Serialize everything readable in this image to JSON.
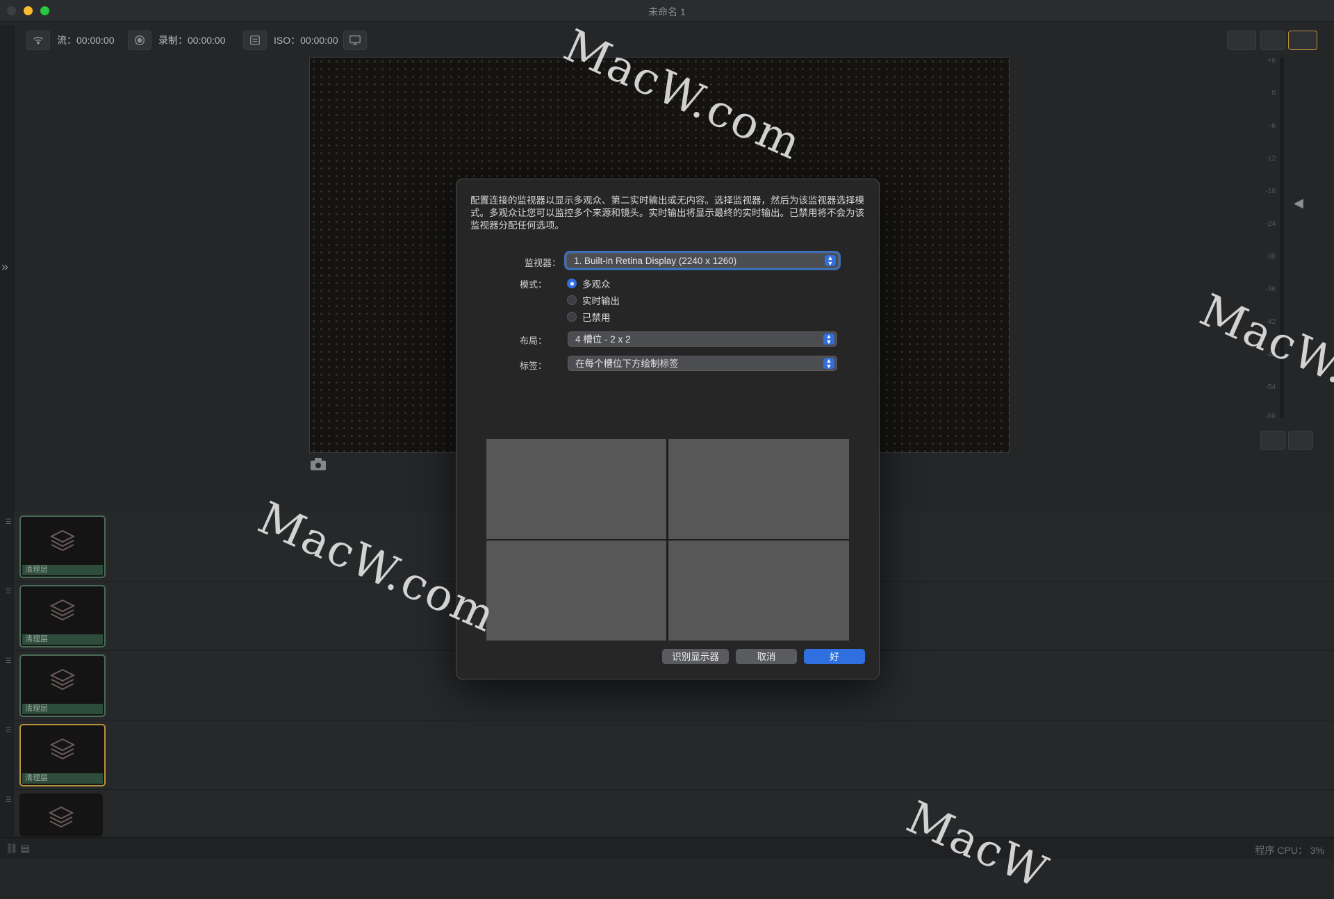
{
  "window": {
    "title": "未命名 1"
  },
  "toolbar": {
    "stream": "流：00:00:00",
    "record": "录制：00:00:00",
    "iso": "ISO：00:00:00"
  },
  "meter": {
    "labels": [
      "+6",
      "0",
      "-6",
      "-12",
      "-18",
      "-24",
      "-30",
      "-36",
      "-42",
      "-48",
      "-54",
      "-60"
    ]
  },
  "dialog": {
    "description": "配置连接的监视器以显示多观众、第二实时输出或无内容。选择监视器，然后为该监视器选择模式。多观众让您可以监控多个来源和镜头。实时输出将显示最终的实时输出。已禁用将不会为该监视器分配任何选项。",
    "monitor_label": "监视器：",
    "monitor_value": "1. Built-in Retina Display (2240 x 1260)",
    "mode_label": "模式：",
    "modes": [
      {
        "label": "多观众",
        "selected": true
      },
      {
        "label": "实时输出",
        "selected": false
      },
      {
        "label": "已禁用",
        "selected": false
      }
    ],
    "layout_label": "布局：",
    "layout_value": "4 槽位 - 2 x 2",
    "labels_label": "标签：",
    "labels_value": "在每个槽位下方绘制标签",
    "btn_identify": "识别显示器",
    "btn_cancel": "取消",
    "btn_ok": "好"
  },
  "layers": [
    {
      "label": "清理层",
      "selected": false
    },
    {
      "label": "清理层",
      "selected": false
    },
    {
      "label": "清理层",
      "selected": false
    },
    {
      "label": "清理层",
      "selected": true
    },
    {
      "label": "",
      "selected": false
    }
  ],
  "status": {
    "cpu": "程序 CPU：  3%"
  },
  "watermarks": [
    "MacW.com",
    "MacW.com",
    "MacW.c",
    "MacW"
  ],
  "colors": {
    "accent": "#2f6fdf",
    "layer_border": "#4a6b55",
    "layer_selected": "#b7923b"
  }
}
